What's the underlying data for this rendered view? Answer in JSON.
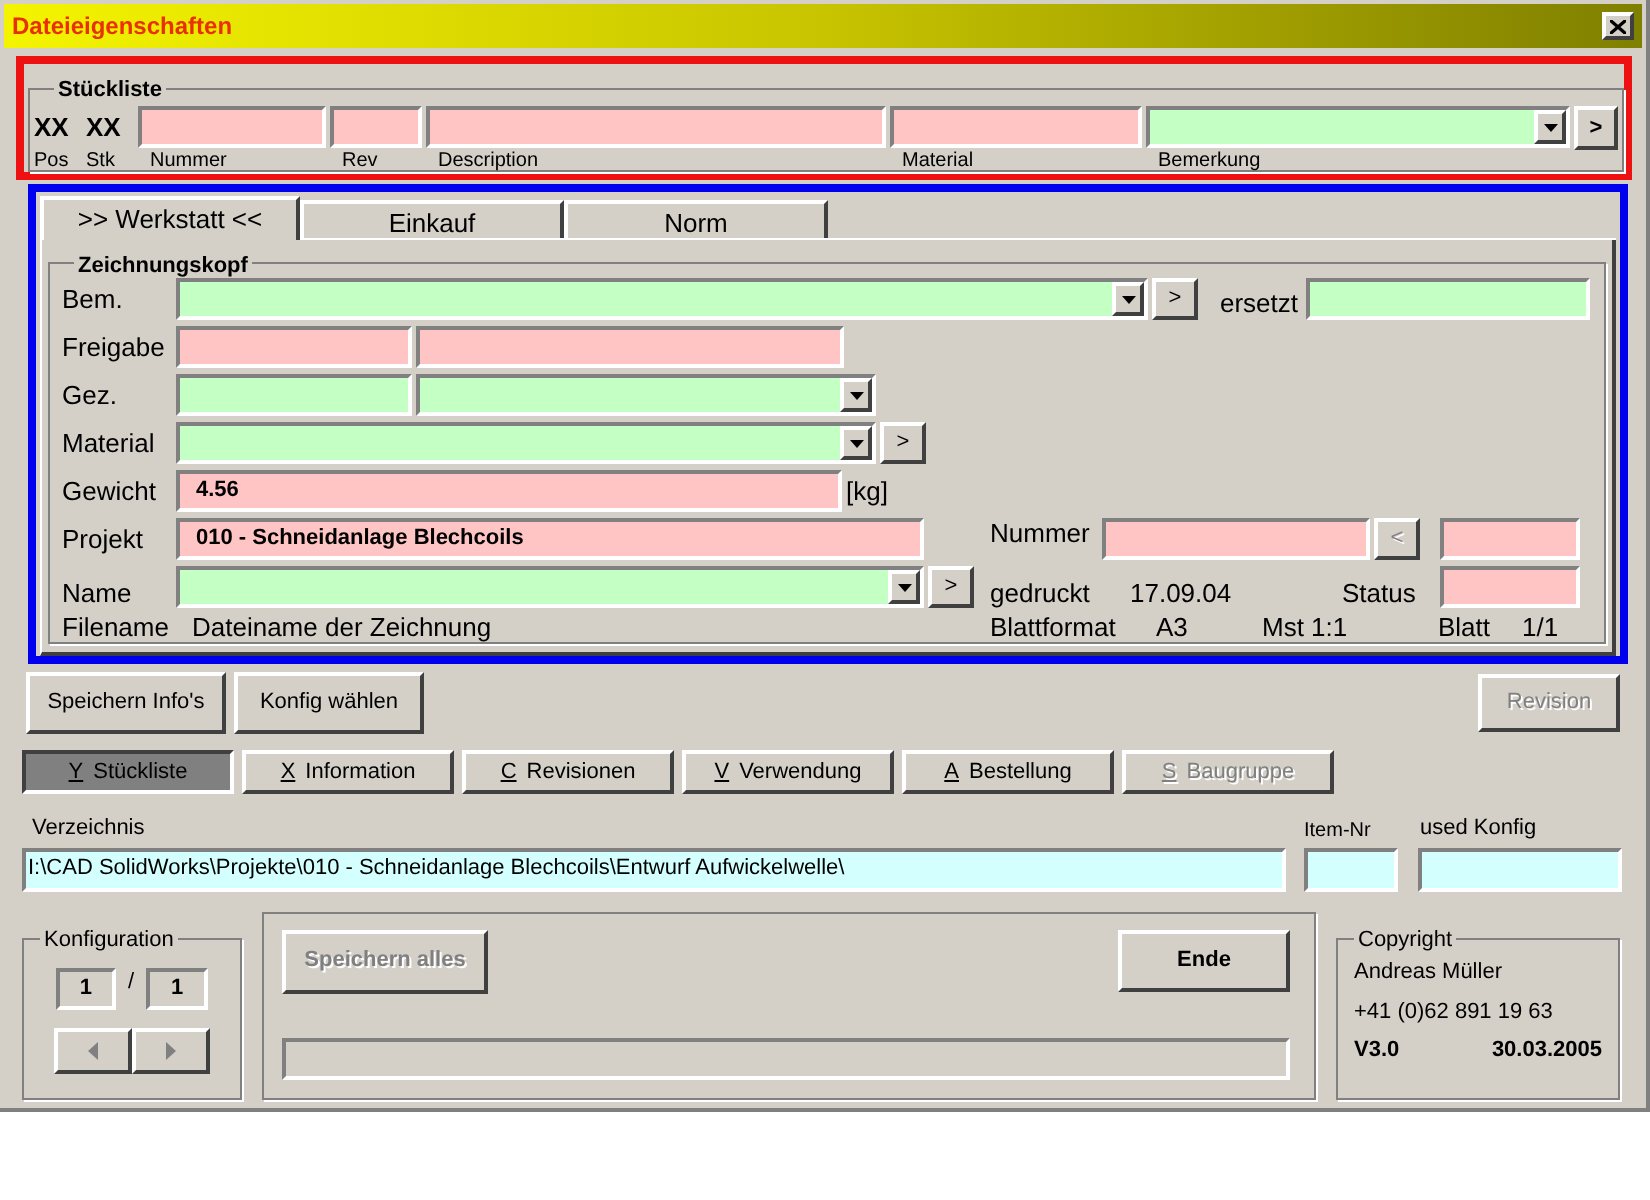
{
  "window": {
    "title": "Dateieigenschaften"
  },
  "stueckliste": {
    "title": "Stückliste",
    "pos": {
      "value": "XX",
      "label": "Pos"
    },
    "stk": {
      "value": "XX",
      "label": "Stk"
    },
    "fields": [
      {
        "label": "Nummer",
        "kind": "text",
        "color": "#ffc4c4"
      },
      {
        "label": "Rev",
        "kind": "text",
        "color": "#ffc4c4"
      },
      {
        "label": "Description",
        "kind": "text",
        "color": "#ffc4c4"
      },
      {
        "label": "Material",
        "kind": "text",
        "color": "#ffc4c4"
      },
      {
        "label": "Bemerkung",
        "kind": "combo",
        "color": "#c4ffc4"
      }
    ],
    "button": ">"
  },
  "tabs": [
    {
      "label": ">> Werkstatt <<",
      "selected": true
    },
    {
      "label": "Einkauf",
      "selected": false
    },
    {
      "label": "Norm",
      "selected": false
    }
  ],
  "zeichnungskopf": {
    "title": "Zeichnungskopf",
    "bem": {
      "label": "Bem.",
      "field": {
        "color": "#c4ffc4"
      },
      "button": ">",
      "ersetzt": {
        "label": "ersetzt",
        "field": {
          "color": "#c4ffc4"
        }
      }
    },
    "freigabe": {
      "label": "Freigabe",
      "fields": [
        {
          "color": "#ffc4c4"
        },
        {
          "color": "#ffc4c4"
        }
      ]
    },
    "gez": {
      "label": "Gez.",
      "fields": [
        {
          "color": "#c4ffc4"
        },
        {
          "color": "#c4ffc4"
        }
      ]
    },
    "material": {
      "label": "Material",
      "field": {
        "color": "#c4ffc4"
      },
      "button": ">"
    },
    "gewicht": {
      "label": "Gewicht",
      "field": {
        "color": "#ffc4c4",
        "value": "4.56"
      },
      "unit": "[kg]"
    },
    "projekt": {
      "label": "Projekt",
      "field": {
        "color": "#ffc4c4",
        "value": "010 - Schneidanlage Blechcoils"
      }
    },
    "nummer": {
      "label": "Nummer",
      "field": {
        "color": "#ffc4c4"
      },
      "button": "<",
      "button_disabled": true,
      "extra_field": {
        "color": "#ffc4c4"
      }
    },
    "name": {
      "label": "Name",
      "field": {
        "color": "#c4ffc4"
      },
      "button": ">"
    },
    "gedruckt": {
      "label": "gedruckt",
      "value": "17.09.04"
    },
    "status": {
      "label": "Status",
      "field": {
        "color": "#ffc4c4"
      }
    },
    "filename": {
      "label": "Filename",
      "value": "Dateiname der Zeichnung"
    },
    "blattformat": {
      "label": "Blattformat",
      "value": "A3"
    },
    "massstab": "Mst 1:1",
    "blatt": {
      "label": "Blatt",
      "value": "1/1"
    }
  },
  "actions": [
    {
      "label": "Speichern Info's",
      "disabled": false
    },
    {
      "label": "Konfig wählen",
      "disabled": false
    },
    {
      "label": "Revision",
      "disabled": true
    }
  ],
  "nav": [
    {
      "key": "Y",
      "label": "Stückliste",
      "selected": true,
      "disabled": false
    },
    {
      "key": "X",
      "label": "Information",
      "selected": false,
      "disabled": false
    },
    {
      "key": "C",
      "label": "Revisionen",
      "selected": false,
      "disabled": false
    },
    {
      "key": "V",
      "label": "Verwendung",
      "selected": false,
      "disabled": false
    },
    {
      "key": "A",
      "label": "Bestellung",
      "selected": false,
      "disabled": false
    },
    {
      "key": "S",
      "label": "Baugruppe",
      "selected": false,
      "disabled": true
    }
  ],
  "verzeichnis": {
    "label": "Verzeichnis",
    "value": "I:\\CAD SolidWorks\\Projekte\\010 - Schneidanlage Blechcoils\\Entwurf Aufwickelwelle\\"
  },
  "item_nr": {
    "label": "Item-Nr"
  },
  "used_konfig": {
    "label": "used Konfig"
  },
  "konfiguration": {
    "title": "Konfiguration",
    "current": "1",
    "separator": "/",
    "total": "1",
    "arrows_disabled": true
  },
  "speichern_alles": {
    "label": "Speichern alles",
    "disabled": true
  },
  "ende": {
    "label": "Ende",
    "disabled": false
  },
  "progress": {
    "level": 0
  },
  "copyright": {
    "title": "Copyright",
    "name": "Andreas Müller",
    "phone": "+41 (0)62 891 19 63",
    "version": "V3.0",
    "date": "30.03.2005"
  }
}
